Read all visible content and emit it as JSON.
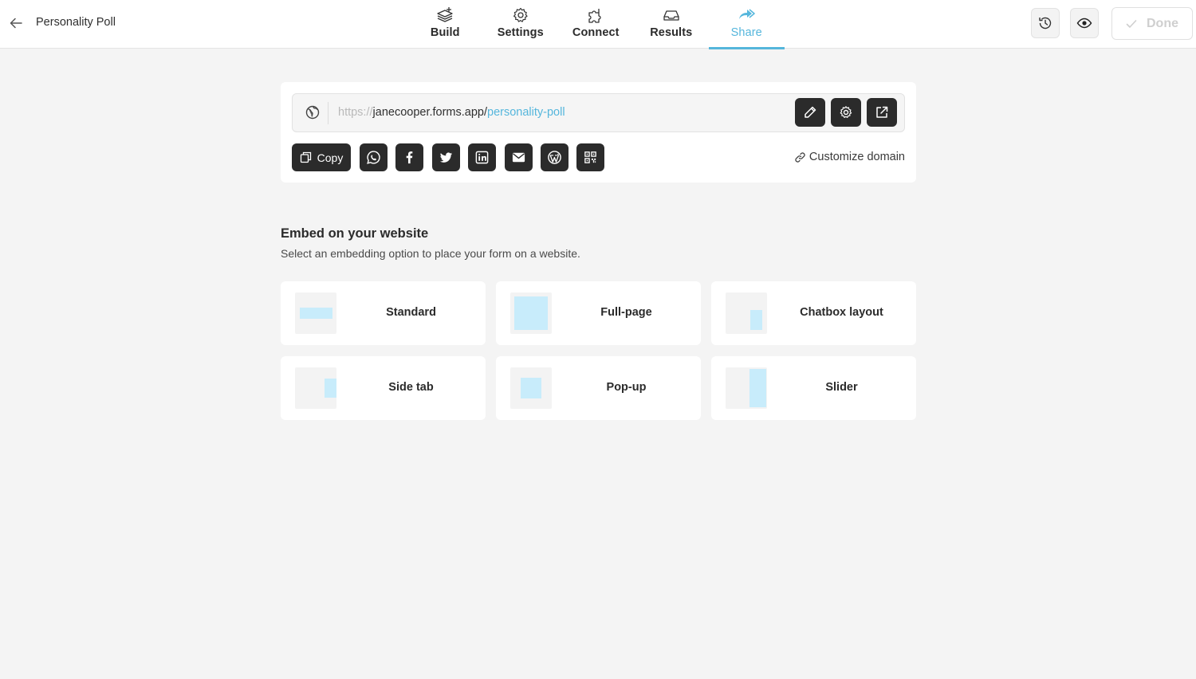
{
  "header": {
    "title": "Personality Poll",
    "tabs": [
      {
        "label": "Build",
        "icon": "build-icon"
      },
      {
        "label": "Settings",
        "icon": "gear-icon"
      },
      {
        "label": "Connect",
        "icon": "puzzle-icon"
      },
      {
        "label": "Results",
        "icon": "inbox-icon"
      },
      {
        "label": "Share",
        "icon": "share-icon",
        "active": true
      }
    ],
    "done_label": "Done"
  },
  "share": {
    "url_protocol": "https://",
    "url_host": "janecooper.forms.app/",
    "url_slug": "personality-poll",
    "copy_label": "Copy",
    "customize_label": "Customize domain",
    "social_icons": [
      "whatsapp-icon",
      "facebook-icon",
      "twitter-icon",
      "linkedin-icon",
      "email-icon",
      "wordpress-icon",
      "qr-code-icon"
    ]
  },
  "embed": {
    "title": "Embed on your website",
    "subtitle": "Select an embedding option to place your form on a website.",
    "options": [
      {
        "label": "Standard"
      },
      {
        "label": "Full-page"
      },
      {
        "label": "Chatbox layout"
      },
      {
        "label": "Side tab"
      },
      {
        "label": "Pop-up"
      },
      {
        "label": "Slider"
      }
    ]
  },
  "colors": {
    "accent": "#55b6dc",
    "dark": "#2b2b2b",
    "thumb_fill": "#c8ecfb",
    "background": "#f4f4f4"
  }
}
